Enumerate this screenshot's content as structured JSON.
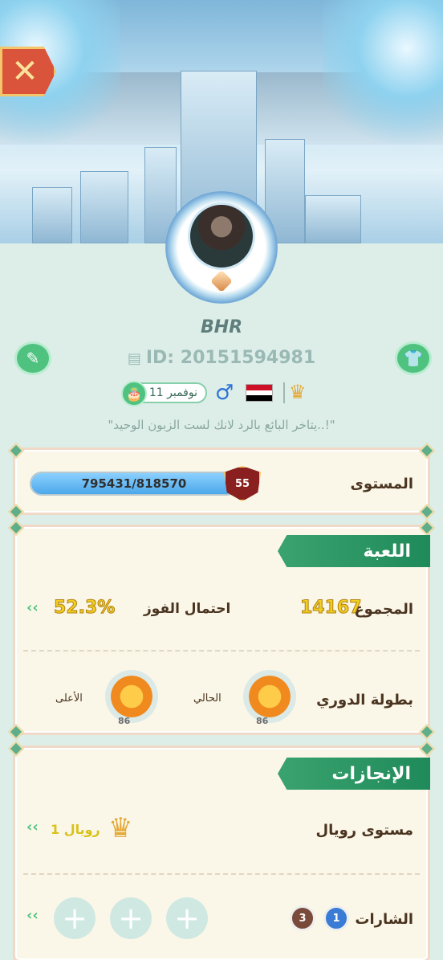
{
  "header": {
    "close_icon": "x-icon"
  },
  "profile": {
    "name": "BHR",
    "id_text": "ID: 20151594981",
    "birthday": "11 نوفمبر",
    "gender_symbol": "♂",
    "bio": "\"يتاخر البائع بالرد لانك لست الزبون الوحيد..!\""
  },
  "icons": {
    "edit": "edit-icon",
    "shirt": "shirt-icon",
    "copy": "copy-icon",
    "cake": "cake-icon",
    "crown": "crown-icon"
  },
  "level": {
    "label": "المستوى",
    "current": 795431,
    "max": 818570,
    "text": "795431/818570",
    "badge": "55",
    "progress": 0.972
  },
  "game": {
    "title": "اللعبة",
    "total_label": "المجموع",
    "total_value": "14167",
    "winrate_label": "احتمال الفوز",
    "winrate_value": "52.3%",
    "league_label": "بطولة الدوري",
    "current_label": "الحالي",
    "highest_label": "الأعلى",
    "current_badge_num": "86",
    "highest_badge_num": "86"
  },
  "achievements": {
    "title": "الإنجازات",
    "royal_label": "مستوى رويال",
    "royal_value": "رويال 1",
    "badges_label": "الشارات",
    "badge_count_1": "1",
    "badge_count_2": "3",
    "plus_symbol": "+"
  },
  "colors": {
    "accent_green": "#4fc27f",
    "header_green": "#1f8a5a",
    "yellow": "#f1cf22"
  }
}
